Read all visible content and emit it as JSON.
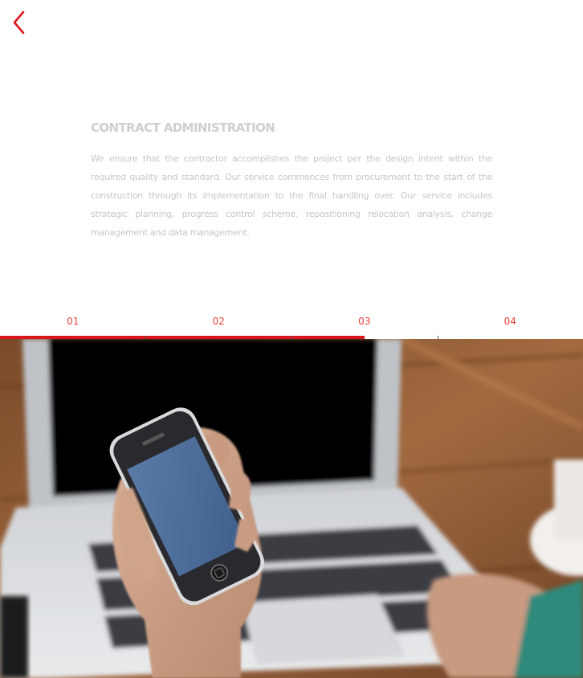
{
  "nav": {
    "back_icon": "chevron-left-icon",
    "accent_color": "#d9161c"
  },
  "section": {
    "title": "CONTRACT ADMINISTRATION",
    "body": "We ensure that the contractor accomplishes the project per the design intent within the required quality and standard. Our service commences from procurement to the start of the construction through its implementation to the final handling over. Our service includes strategic planning, progress control scheme, repositioning relocation analysis, change management and data management."
  },
  "tabs": [
    {
      "label": "01"
    },
    {
      "label": "02"
    },
    {
      "label": "03"
    },
    {
      "label": "04"
    }
  ],
  "progress": {
    "fraction": 0.625,
    "color": "#d9161c"
  },
  "hero_image": {
    "subject": "hand holding smartphone in front of laptop"
  }
}
